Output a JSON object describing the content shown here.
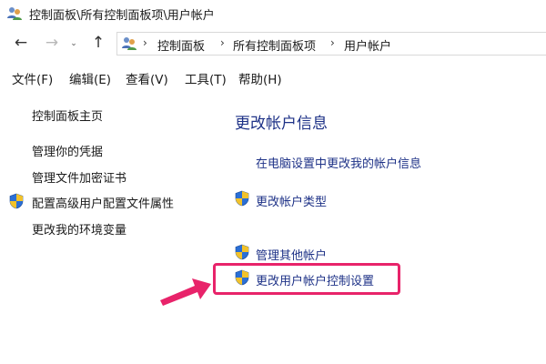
{
  "window": {
    "title": "控制面板\\所有控制面板项\\用户帐户"
  },
  "address": {
    "crumbs": [
      "控制面板",
      "所有控制面板项",
      "用户帐户"
    ]
  },
  "menu": [
    "文件(F)",
    "编辑(E)",
    "查看(V)",
    "工具(T)",
    "帮助(H)"
  ],
  "sidebar": {
    "home": "控制面板主页",
    "items": [
      "管理你的凭据",
      "管理文件加密证书",
      "配置高级用户配置文件属性",
      "更改我的环境变量"
    ]
  },
  "main": {
    "title": "更改帐户信息",
    "links": [
      "在电脑设置中更改我的帐户信息",
      "更改帐户类型",
      "管理其他帐户",
      "更改用户帐户控制设置"
    ]
  },
  "colors": {
    "link": "#1e3287",
    "highlight": "#e8236a"
  }
}
